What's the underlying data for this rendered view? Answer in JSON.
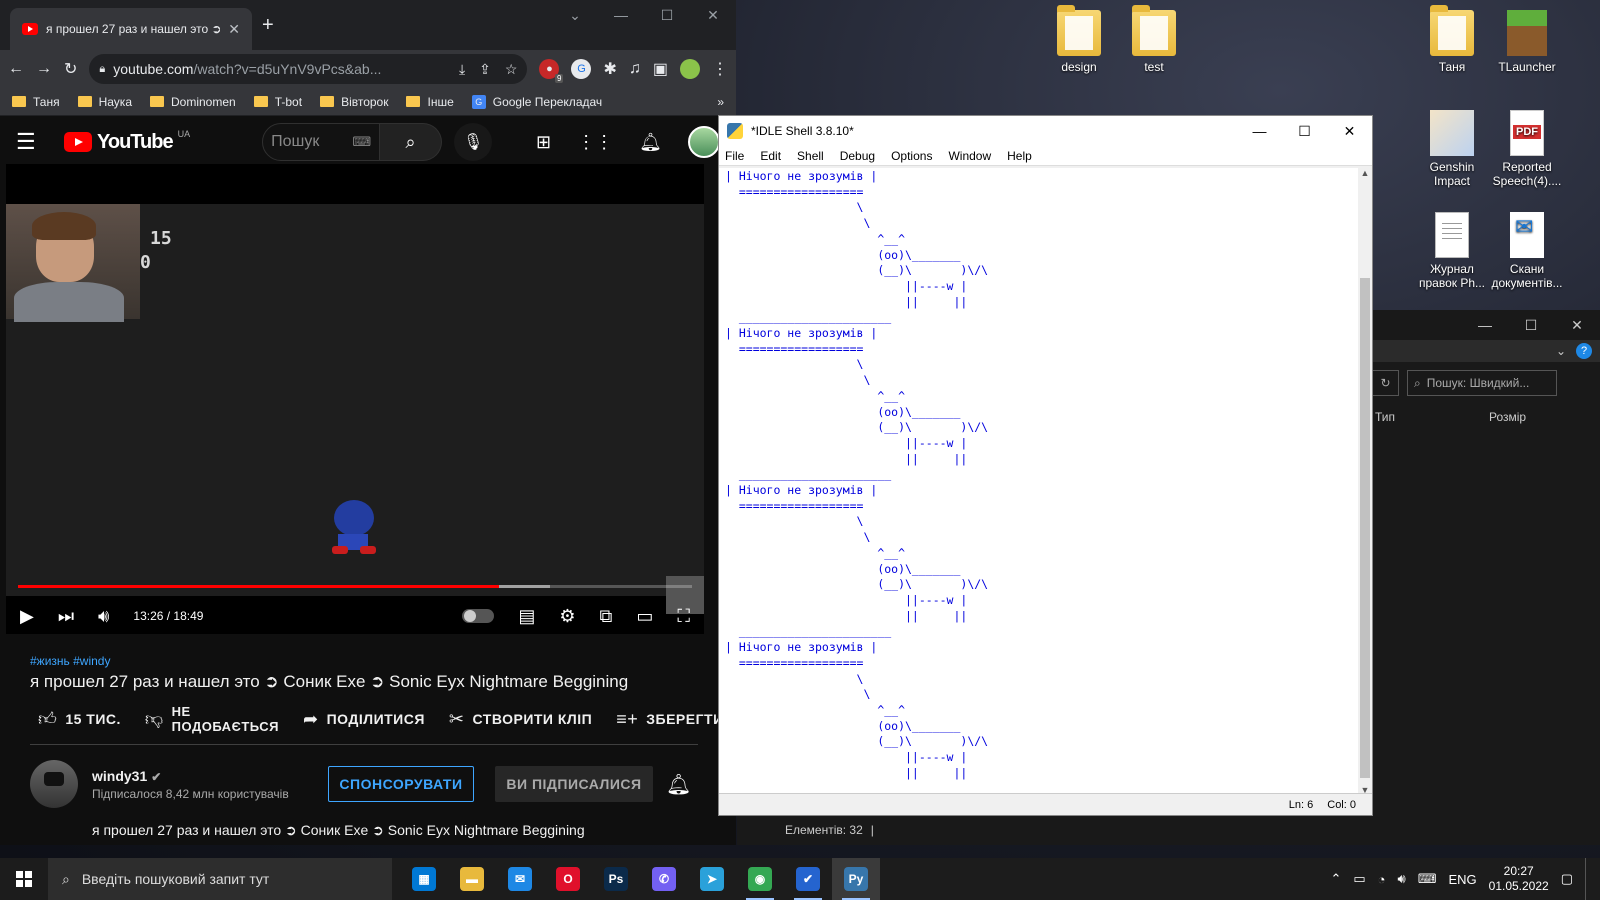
{
  "desktop": {
    "icons": [
      {
        "label": "design",
        "icon": "folder-icon"
      },
      {
        "label": "test",
        "icon": "folder-icon"
      },
      {
        "label": "Таня",
        "icon": "folder-icon"
      },
      {
        "label": "TLauncher",
        "icon": "minecraft-icon"
      },
      {
        "label": "Genshin Impact",
        "icon": "genshin-icon"
      },
      {
        "label": "Reported Speech(4)....",
        "icon": "pdf-icon"
      },
      {
        "label": "Журнал правок Ph...",
        "icon": "document-icon"
      },
      {
        "label": "Скани документів...",
        "icon": "scan-icon"
      }
    ]
  },
  "chrome": {
    "tab_title": "я прошел 27 раз и нашел это ➲",
    "url_host": "youtube.com",
    "url_path": "/watch?v=d5uYnV9vPcs&ab...",
    "extension_badge": "9",
    "bookmarks": [
      "Таня",
      "Наука",
      "Dominomen",
      "T-bot",
      "Вівторок",
      "Інше",
      "Google Перекладач"
    ]
  },
  "youtube": {
    "logo_text": "YouTube",
    "region": "UA",
    "search_placeholder": "Пошук",
    "player": {
      "current_time": "13:26",
      "duration": "18:49",
      "time_display": "13:26 / 18:49",
      "progress": 0.714,
      "buffered": 0.79,
      "game_numbers": [
        "15",
        "0"
      ]
    },
    "tags": "#жизнь #windy",
    "title": "я прошел 27 раз и нашел это ➲ Соник Exe ➲ Sonic Eyx Nightmare Beggining",
    "actions": {
      "like": "15 ТИС.",
      "dislike_line1": "НЕ",
      "dislike_line2": "ПОДОБАЄТЬСЯ",
      "share": "ПОДІЛИТИСЯ",
      "clip": "СТВОРИТИ КЛІП",
      "save": "ЗБЕРЕГТИ"
    },
    "channel": {
      "name": "windy31",
      "subscribers": "Підписалося 8,42 млн користувачів",
      "sponsor": "СПОНСОРУВАТИ",
      "subscribed": "ВИ ПІДПИСАЛИСЯ"
    },
    "description": "я прошел 27 раз и нашел это ➲ Соник Exe ➲ Sonic Eyx Nightmare Beggining"
  },
  "idle": {
    "title": "*IDLE Shell 3.8.10*",
    "menu": [
      "File",
      "Edit",
      "Shell",
      "Debug",
      "Options",
      "Window",
      "Help"
    ],
    "speech": "Нічого не зрозумів",
    "repeat_count": 4,
    "status_ln": "Ln: 6",
    "status_col": "Col: 0"
  },
  "explorer": {
    "search_placeholder": "Пошук: Швидкий...",
    "col_type": "Тип",
    "col_size": "Розмір",
    "status": "Елементів: 32"
  },
  "taskbar": {
    "search_placeholder": "Введіть пошуковий запит тут",
    "apps": [
      {
        "name": "microsoft-store",
        "color": "#0078d4",
        "glyph": "▦"
      },
      {
        "name": "file-explorer",
        "color": "#e8b93c",
        "glyph": "▬"
      },
      {
        "name": "mail",
        "color": "#1e88e5",
        "glyph": "✉"
      },
      {
        "name": "opera",
        "color": "#e0102b",
        "glyph": "O"
      },
      {
        "name": "photoshop",
        "color": "#0b2a4a",
        "glyph": "Ps"
      },
      {
        "name": "viber",
        "color": "#7360f2",
        "glyph": "✆"
      },
      {
        "name": "telegram",
        "color": "#2aa1da",
        "glyph": "➤"
      },
      {
        "name": "chrome",
        "color": "#34a853",
        "glyph": "◉"
      },
      {
        "name": "todo",
        "color": "#2564cf",
        "glyph": "✔"
      },
      {
        "name": "python-idle",
        "color": "#3776ab",
        "glyph": "Py"
      }
    ],
    "language": "ENG",
    "time": "20:27",
    "date": "01.05.2022"
  }
}
